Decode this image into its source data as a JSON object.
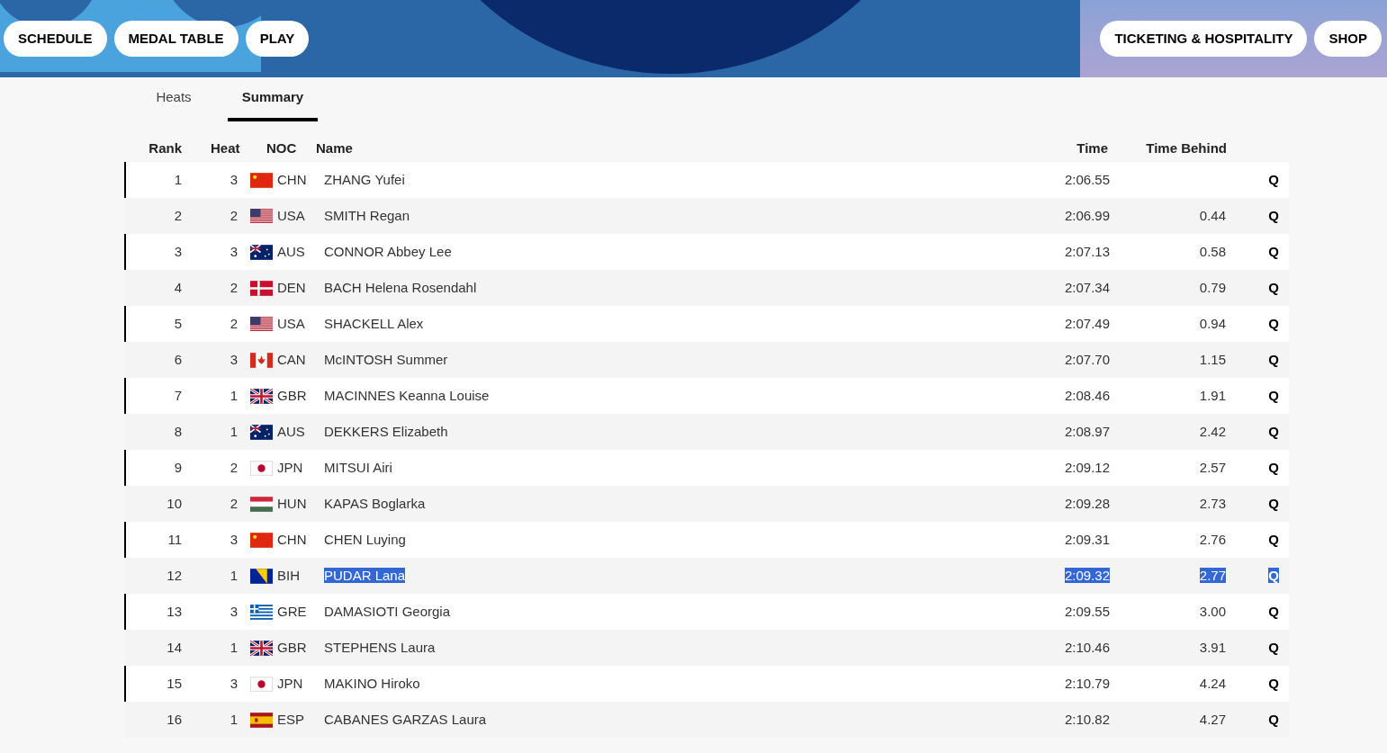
{
  "nav_left": [
    {
      "label": "SCHEDULE"
    },
    {
      "label": "MEDAL TABLE"
    },
    {
      "label": "PLAY"
    }
  ],
  "nav_right": [
    {
      "label": "TICKETING & HOSPITALITY"
    },
    {
      "label": "SHOP"
    }
  ],
  "tabs": [
    {
      "label": "Heats",
      "selected": false
    },
    {
      "label": "Summary",
      "selected": true
    }
  ],
  "table": {
    "columns": [
      "Rank",
      "Heat",
      "NOC",
      "Name",
      "Time",
      "Time Behind"
    ],
    "rows": [
      {
        "rank": "1",
        "heat": "3",
        "kind": "cn",
        "noc": "CHN",
        "name": "ZHANG Yufei",
        "time": "2:06.55",
        "q": "Q",
        "selected": false
      },
      {
        "rank": "2",
        "heat": "2",
        "kind": "us",
        "noc": "USA",
        "name": "SMITH Regan",
        "time": "2:06.99",
        "behind": "0.44",
        "q": "Q",
        "selected": false
      },
      {
        "rank": "3",
        "heat": "3",
        "kind": "au",
        "noc": "AUS",
        "name": "CONNOR Abbey Lee",
        "time": "2:07.13",
        "behind": "0.58",
        "q": "Q",
        "selected": false
      },
      {
        "rank": "4",
        "heat": "2",
        "kind": "dk",
        "noc": "DEN",
        "name": "BACH Helena Rosendahl",
        "time": "2:07.34",
        "behind": "0.79",
        "q": "Q",
        "selected": false
      },
      {
        "rank": "5",
        "heat": "2",
        "kind": "us",
        "noc": "USA",
        "name": "SHACKELL Alex",
        "time": "2:07.49",
        "behind": "0.94",
        "q": "Q",
        "selected": false
      },
      {
        "rank": "6",
        "heat": "3",
        "kind": "ca",
        "noc": "CAN",
        "name": "McINTOSH Summer",
        "time": "2:07.70",
        "behind": "1.15",
        "q": "Q",
        "selected": false
      },
      {
        "rank": "7",
        "heat": "1",
        "kind": "gb",
        "noc": "GBR",
        "name": "MACINNES Keanna Louise",
        "time": "2:08.46",
        "behind": "1.91",
        "q": "Q",
        "selected": false
      },
      {
        "rank": "8",
        "heat": "1",
        "kind": "au",
        "noc": "AUS",
        "name": "DEKKERS Elizabeth",
        "time": "2:08.97",
        "behind": "2.42",
        "q": "Q",
        "selected": false
      },
      {
        "rank": "9",
        "heat": "2",
        "kind": "jp",
        "noc": "JPN",
        "name": "MITSUI Airi",
        "time": "2:09.12",
        "behind": "2.57",
        "q": "Q",
        "selected": false
      },
      {
        "rank": "10",
        "heat": "2",
        "kind": "hu",
        "noc": "HUN",
        "name": "KAPAS Boglarka",
        "time": "2:09.28",
        "behind": "2.73",
        "q": "Q",
        "selected": false
      },
      {
        "rank": "11",
        "heat": "3",
        "kind": "cn",
        "noc": "CHN",
        "name": "CHEN Luying",
        "time": "2:09.31",
        "behind": "2.76",
        "q": "Q",
        "selected": false
      },
      {
        "rank": "12",
        "heat": "1",
        "kind": "ba",
        "noc": "BIH",
        "name": "PUDAR Lana",
        "time": "2:09.32",
        "behind": "2.77",
        "q": "Q",
        "selected": true
      },
      {
        "rank": "13",
        "heat": "3",
        "kind": "gr",
        "noc": "GRE",
        "name": "DAMASIOTI Georgia",
        "time": "2:09.55",
        "behind": "3.00",
        "q": "Q",
        "selected": false
      },
      {
        "rank": "14",
        "heat": "1",
        "kind": "gb",
        "noc": "GBR",
        "name": "STEPHENS Laura",
        "time": "2:10.46",
        "behind": "3.91",
        "q": "Q",
        "selected": false
      },
      {
        "rank": "15",
        "heat": "3",
        "kind": "jp",
        "noc": "JPN",
        "name": "MAKINO Hiroko",
        "time": "2:10.79",
        "behind": "4.24",
        "q": "Q",
        "selected": false
      },
      {
        "rank": "16",
        "heat": "1",
        "kind": "es",
        "noc": "ESP",
        "name": "CABANES GARZAS Laura",
        "time": "2:10.82",
        "behind": "4.27",
        "q": "Q",
        "selected": false
      }
    ]
  }
}
